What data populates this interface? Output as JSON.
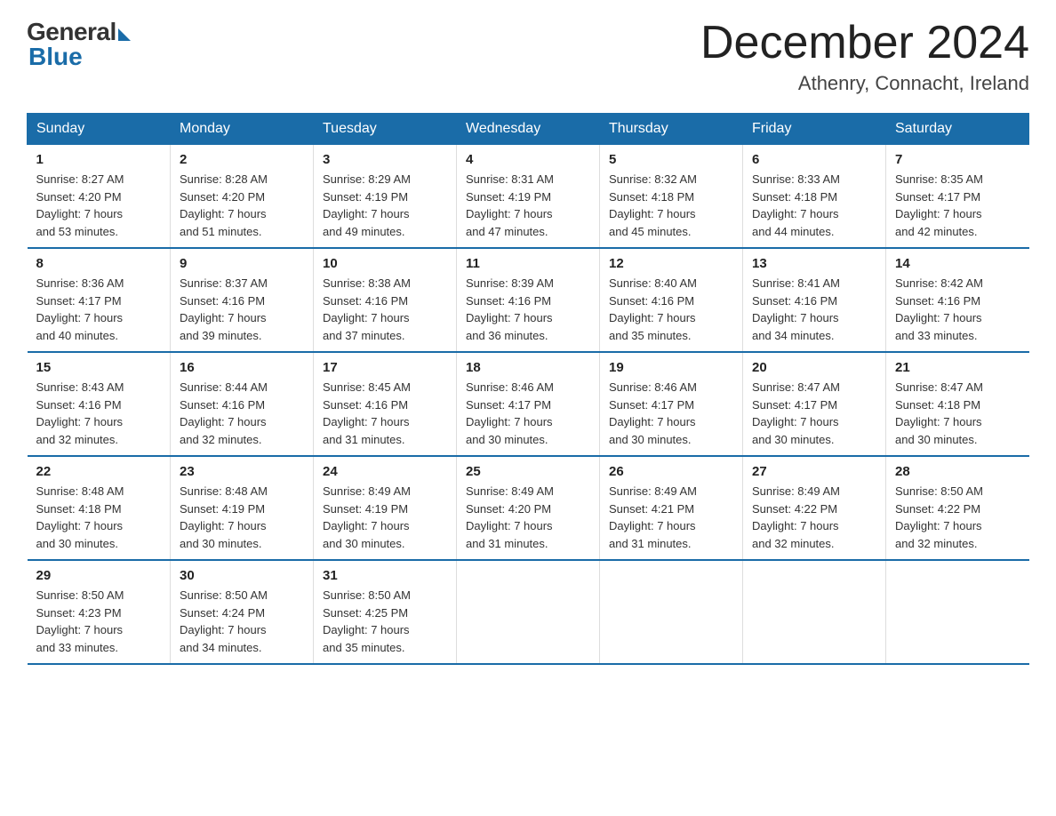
{
  "header": {
    "logo_general": "General",
    "logo_blue": "Blue",
    "month_title": "December 2024",
    "location": "Athenry, Connacht, Ireland"
  },
  "days_of_week": [
    "Sunday",
    "Monday",
    "Tuesday",
    "Wednesday",
    "Thursday",
    "Friday",
    "Saturday"
  ],
  "weeks": [
    [
      {
        "day": "1",
        "info": "Sunrise: 8:27 AM\nSunset: 4:20 PM\nDaylight: 7 hours\nand 53 minutes."
      },
      {
        "day": "2",
        "info": "Sunrise: 8:28 AM\nSunset: 4:20 PM\nDaylight: 7 hours\nand 51 minutes."
      },
      {
        "day": "3",
        "info": "Sunrise: 8:29 AM\nSunset: 4:19 PM\nDaylight: 7 hours\nand 49 minutes."
      },
      {
        "day": "4",
        "info": "Sunrise: 8:31 AM\nSunset: 4:19 PM\nDaylight: 7 hours\nand 47 minutes."
      },
      {
        "day": "5",
        "info": "Sunrise: 8:32 AM\nSunset: 4:18 PM\nDaylight: 7 hours\nand 45 minutes."
      },
      {
        "day": "6",
        "info": "Sunrise: 8:33 AM\nSunset: 4:18 PM\nDaylight: 7 hours\nand 44 minutes."
      },
      {
        "day": "7",
        "info": "Sunrise: 8:35 AM\nSunset: 4:17 PM\nDaylight: 7 hours\nand 42 minutes."
      }
    ],
    [
      {
        "day": "8",
        "info": "Sunrise: 8:36 AM\nSunset: 4:17 PM\nDaylight: 7 hours\nand 40 minutes."
      },
      {
        "day": "9",
        "info": "Sunrise: 8:37 AM\nSunset: 4:16 PM\nDaylight: 7 hours\nand 39 minutes."
      },
      {
        "day": "10",
        "info": "Sunrise: 8:38 AM\nSunset: 4:16 PM\nDaylight: 7 hours\nand 37 minutes."
      },
      {
        "day": "11",
        "info": "Sunrise: 8:39 AM\nSunset: 4:16 PM\nDaylight: 7 hours\nand 36 minutes."
      },
      {
        "day": "12",
        "info": "Sunrise: 8:40 AM\nSunset: 4:16 PM\nDaylight: 7 hours\nand 35 minutes."
      },
      {
        "day": "13",
        "info": "Sunrise: 8:41 AM\nSunset: 4:16 PM\nDaylight: 7 hours\nand 34 minutes."
      },
      {
        "day": "14",
        "info": "Sunrise: 8:42 AM\nSunset: 4:16 PM\nDaylight: 7 hours\nand 33 minutes."
      }
    ],
    [
      {
        "day": "15",
        "info": "Sunrise: 8:43 AM\nSunset: 4:16 PM\nDaylight: 7 hours\nand 32 minutes."
      },
      {
        "day": "16",
        "info": "Sunrise: 8:44 AM\nSunset: 4:16 PM\nDaylight: 7 hours\nand 32 minutes."
      },
      {
        "day": "17",
        "info": "Sunrise: 8:45 AM\nSunset: 4:16 PM\nDaylight: 7 hours\nand 31 minutes."
      },
      {
        "day": "18",
        "info": "Sunrise: 8:46 AM\nSunset: 4:17 PM\nDaylight: 7 hours\nand 30 minutes."
      },
      {
        "day": "19",
        "info": "Sunrise: 8:46 AM\nSunset: 4:17 PM\nDaylight: 7 hours\nand 30 minutes."
      },
      {
        "day": "20",
        "info": "Sunrise: 8:47 AM\nSunset: 4:17 PM\nDaylight: 7 hours\nand 30 minutes."
      },
      {
        "day": "21",
        "info": "Sunrise: 8:47 AM\nSunset: 4:18 PM\nDaylight: 7 hours\nand 30 minutes."
      }
    ],
    [
      {
        "day": "22",
        "info": "Sunrise: 8:48 AM\nSunset: 4:18 PM\nDaylight: 7 hours\nand 30 minutes."
      },
      {
        "day": "23",
        "info": "Sunrise: 8:48 AM\nSunset: 4:19 PM\nDaylight: 7 hours\nand 30 minutes."
      },
      {
        "day": "24",
        "info": "Sunrise: 8:49 AM\nSunset: 4:19 PM\nDaylight: 7 hours\nand 30 minutes."
      },
      {
        "day": "25",
        "info": "Sunrise: 8:49 AM\nSunset: 4:20 PM\nDaylight: 7 hours\nand 31 minutes."
      },
      {
        "day": "26",
        "info": "Sunrise: 8:49 AM\nSunset: 4:21 PM\nDaylight: 7 hours\nand 31 minutes."
      },
      {
        "day": "27",
        "info": "Sunrise: 8:49 AM\nSunset: 4:22 PM\nDaylight: 7 hours\nand 32 minutes."
      },
      {
        "day": "28",
        "info": "Sunrise: 8:50 AM\nSunset: 4:22 PM\nDaylight: 7 hours\nand 32 minutes."
      }
    ],
    [
      {
        "day": "29",
        "info": "Sunrise: 8:50 AM\nSunset: 4:23 PM\nDaylight: 7 hours\nand 33 minutes."
      },
      {
        "day": "30",
        "info": "Sunrise: 8:50 AM\nSunset: 4:24 PM\nDaylight: 7 hours\nand 34 minutes."
      },
      {
        "day": "31",
        "info": "Sunrise: 8:50 AM\nSunset: 4:25 PM\nDaylight: 7 hours\nand 35 minutes."
      },
      {
        "day": "",
        "info": ""
      },
      {
        "day": "",
        "info": ""
      },
      {
        "day": "",
        "info": ""
      },
      {
        "day": "",
        "info": ""
      }
    ]
  ]
}
